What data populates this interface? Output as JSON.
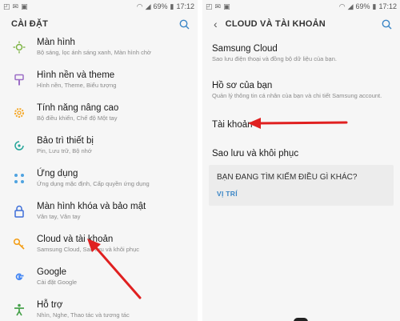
{
  "left": {
    "status": {
      "time": "17:12",
      "battery": "69%"
    },
    "title": "CÀI ĐẶT",
    "items": [
      {
        "title": "Màn hình",
        "subtitle": "Bộ sáng, lọc ánh sáng xanh, Màn hình chờ",
        "icon": "display-icon",
        "color": "#7cb342"
      },
      {
        "title": "Hình nền và theme",
        "subtitle": "Hình nền, Theme, Biểu tượng",
        "icon": "brush-icon",
        "color": "#9c6ec6"
      },
      {
        "title": "Tính năng nâng cao",
        "subtitle": "Bộ điều khiển, Chế độ Một tay",
        "icon": "gear-icon",
        "color": "#f5a623"
      },
      {
        "title": "Bảo trì thiết bị",
        "subtitle": "Pin, Lưu trữ, Bộ nhớ",
        "icon": "maintenance-icon",
        "color": "#26a69a"
      },
      {
        "title": "Ứng dụng",
        "subtitle": "Ứng dụng mặc định, Cấp quyền ứng dụng",
        "icon": "apps-icon",
        "color": "#4fa3e0"
      },
      {
        "title": "Màn hình khóa và bảo mật",
        "subtitle": "Vân tay, Vân tay",
        "icon": "lock-icon",
        "color": "#3f6fd8"
      },
      {
        "title": "Cloud và tài khoản",
        "subtitle": "Samsung Cloud, Sao lưu và khôi phục",
        "icon": "key-icon",
        "color": "#f39c12"
      },
      {
        "title": "Google",
        "subtitle": "Cài đặt Google",
        "icon": "google-icon",
        "color": "#4285f4"
      },
      {
        "title": "Hỗ trợ",
        "subtitle": "Nhìn, Nghe, Thao tác và tương tác",
        "icon": "accessibility-icon",
        "color": "#43a047"
      }
    ]
  },
  "right": {
    "status": {
      "time": "17:12",
      "battery": "69%"
    },
    "title": "CLOUD VÀ TÀI KHOẢN",
    "items": [
      {
        "title": "Samsung Cloud",
        "subtitle": "Sao lưu điện thoại và đồng bộ dữ liệu của bạn."
      },
      {
        "title": "Hồ sơ của bạn",
        "subtitle": "Quản lý thông tin cá nhân của bạn và chi tiết Samsung account."
      },
      {
        "title": "Tài khoản",
        "subtitle": ""
      },
      {
        "title": "Sao lưu và khôi phục",
        "subtitle": ""
      }
    ],
    "card": {
      "title": "BẠN ĐANG TÌM KIẾM ĐIỀU GÌ KHÁC?",
      "link": "VỊ TRÍ"
    }
  },
  "colors": {
    "accent": "#3b86c6",
    "arrow": "#e02020"
  }
}
